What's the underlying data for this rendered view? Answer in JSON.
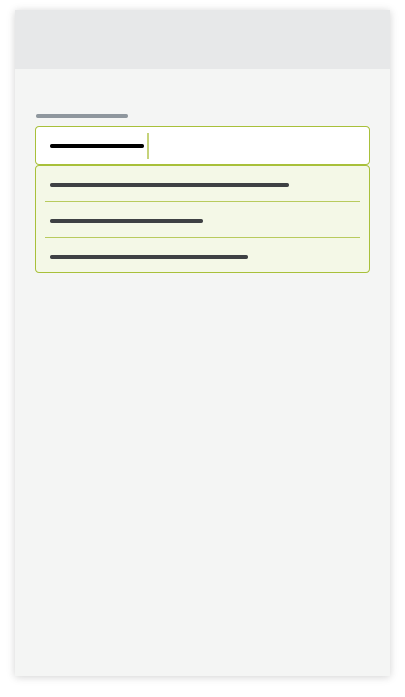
{
  "header": {
    "title": ""
  },
  "form": {
    "field_label": "",
    "input_value": "",
    "placeholder": ""
  },
  "dropdown": {
    "options": [
      {
        "label": ""
      },
      {
        "label": ""
      },
      {
        "label": ""
      }
    ]
  },
  "colors": {
    "header_bg": "#e7e8e9",
    "card_bg": "#f4f5f4",
    "accent_border": "#a8c03a",
    "dropdown_bg": "#f4f8e7",
    "text_placeholder_bar": "#3e4144",
    "label_bar": "#8f979e"
  }
}
